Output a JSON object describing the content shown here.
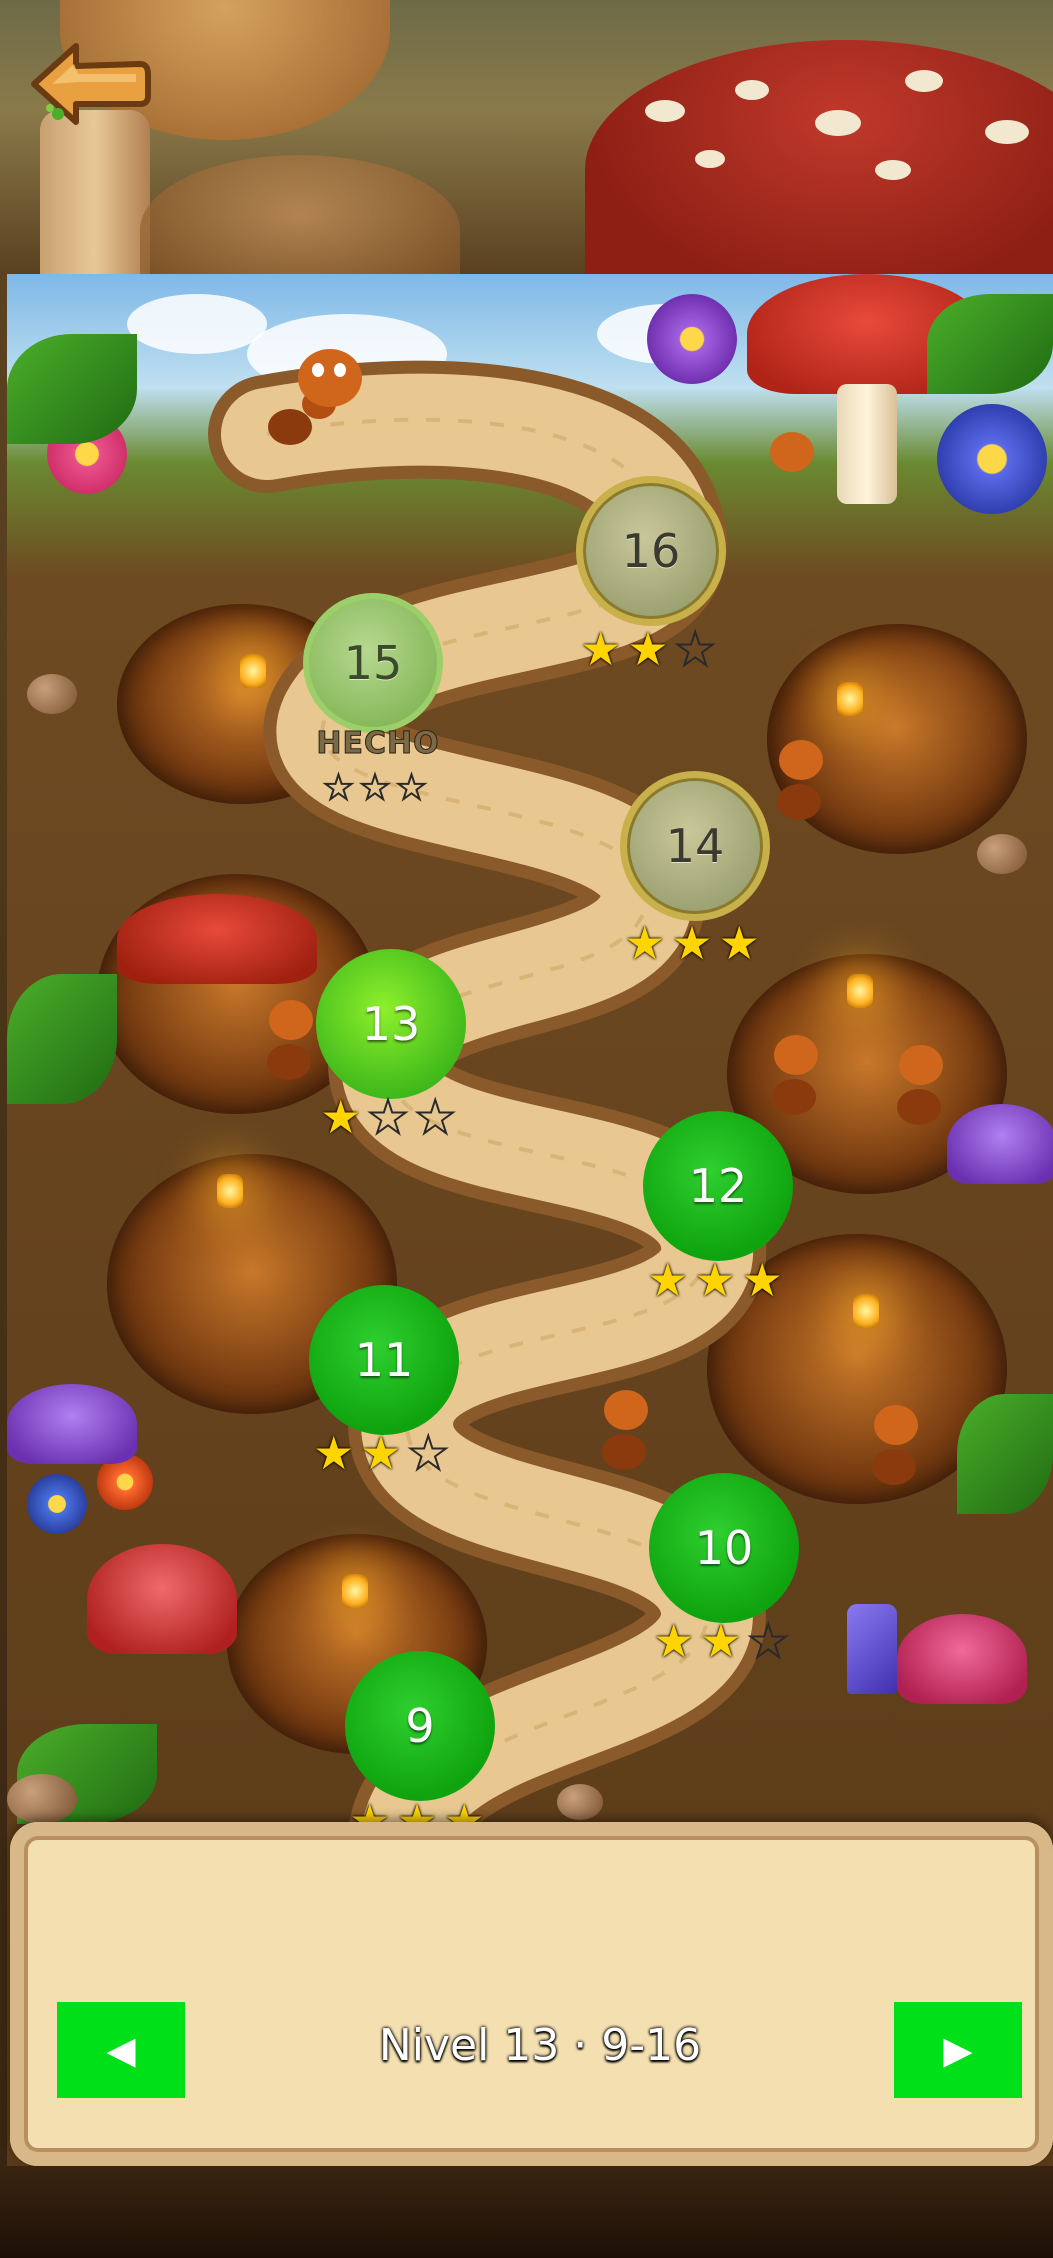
{
  "back_button": {
    "icon": "back-arrow-icon"
  },
  "levels": [
    {
      "number": "16",
      "state": "locked",
      "stars": [
        1,
        1,
        0
      ]
    },
    {
      "number": "15",
      "state": "done-marked",
      "tag": "HECHO",
      "stars": [
        0,
        0,
        0
      ]
    },
    {
      "number": "14",
      "state": "locked",
      "stars": [
        1,
        1,
        1
      ]
    },
    {
      "number": "13",
      "state": "current",
      "stars": [
        1,
        0,
        0
      ]
    },
    {
      "number": "12",
      "state": "done",
      "stars": [
        1,
        1,
        1
      ]
    },
    {
      "number": "11",
      "state": "done",
      "stars": [
        1,
        1,
        0
      ]
    },
    {
      "number": "10",
      "state": "done",
      "stars": [
        1,
        1,
        0
      ]
    },
    {
      "number": "9",
      "state": "done",
      "stars": [
        1,
        1,
        1
      ]
    }
  ],
  "footer": {
    "prev_label": "◀",
    "next_label": "▶",
    "level_text": "Nivel 13 · 9-16"
  },
  "colors": {
    "nav_button": "#00e019",
    "star_filled": "#ffd400",
    "level_done": "#0fa40f",
    "level_current": "#3cb61a",
    "level_locked_ring": "#c8b04a"
  }
}
